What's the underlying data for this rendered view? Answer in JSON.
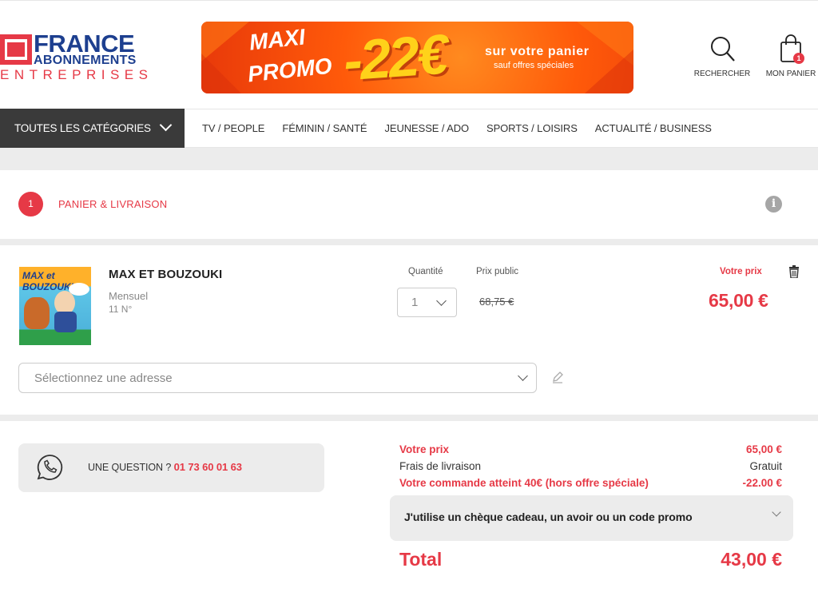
{
  "header": {
    "logo": {
      "line1": "FRANCE",
      "line2": "ABONNEMENTS",
      "line3": "ENTREPRISES"
    },
    "banner": {
      "maxi": "MAXI",
      "promo": "PROMO",
      "amount": "-22€",
      "sub1": "sur votre panier",
      "sub2": "sauf offres spéciales"
    },
    "search_label": "RECHERCHER",
    "cart_label": "MON PANIER",
    "cart_count": "1"
  },
  "nav": {
    "all_categories": "TOUTES LES CATÉGORIES",
    "items": [
      "TV / PEOPLE",
      "FÉMININ / SANTÉ",
      "JEUNESSE / ADO",
      "SPORTS / LOISIRS",
      "ACTUALITÉ / BUSINESS"
    ]
  },
  "step": {
    "number": "1",
    "label": "PANIER & LIVRAISON",
    "info": "i"
  },
  "product": {
    "cover_title": "MAX et BOUZOUKI",
    "title": "MAX ET BOUZOUKI",
    "frequency": "Mensuel",
    "issues": "11 N°",
    "quantity_label": "Quantité",
    "quantity_value": "1",
    "public_price_label": "Prix public",
    "public_price": "68,75 €",
    "your_price_label": "Votre prix",
    "your_price": "65,00 €",
    "address_placeholder": "Sélectionnez une adresse"
  },
  "summary": {
    "question_text": "UNE QUESTION ?",
    "phone": "01 73 60 01 63",
    "rows": [
      {
        "label": "Votre prix",
        "value": "65,00 €"
      },
      {
        "label": "Frais de livraison",
        "value": "Gratuit"
      },
      {
        "label": "Votre commande atteint 40€ (hors offre spéciale)",
        "value": "-22.00 €"
      }
    ],
    "promo_box": "J'utilise un chèque cadeau, un avoir ou un code promo",
    "total_label": "Total",
    "total_value": "43,00 €"
  },
  "colors": {
    "accent": "#e63946",
    "brand_blue": "#1d3f8f",
    "banner_orange": "#ff5a0a",
    "banner_yellow": "#ffd21a",
    "nav_dark": "#3a3a3a"
  }
}
